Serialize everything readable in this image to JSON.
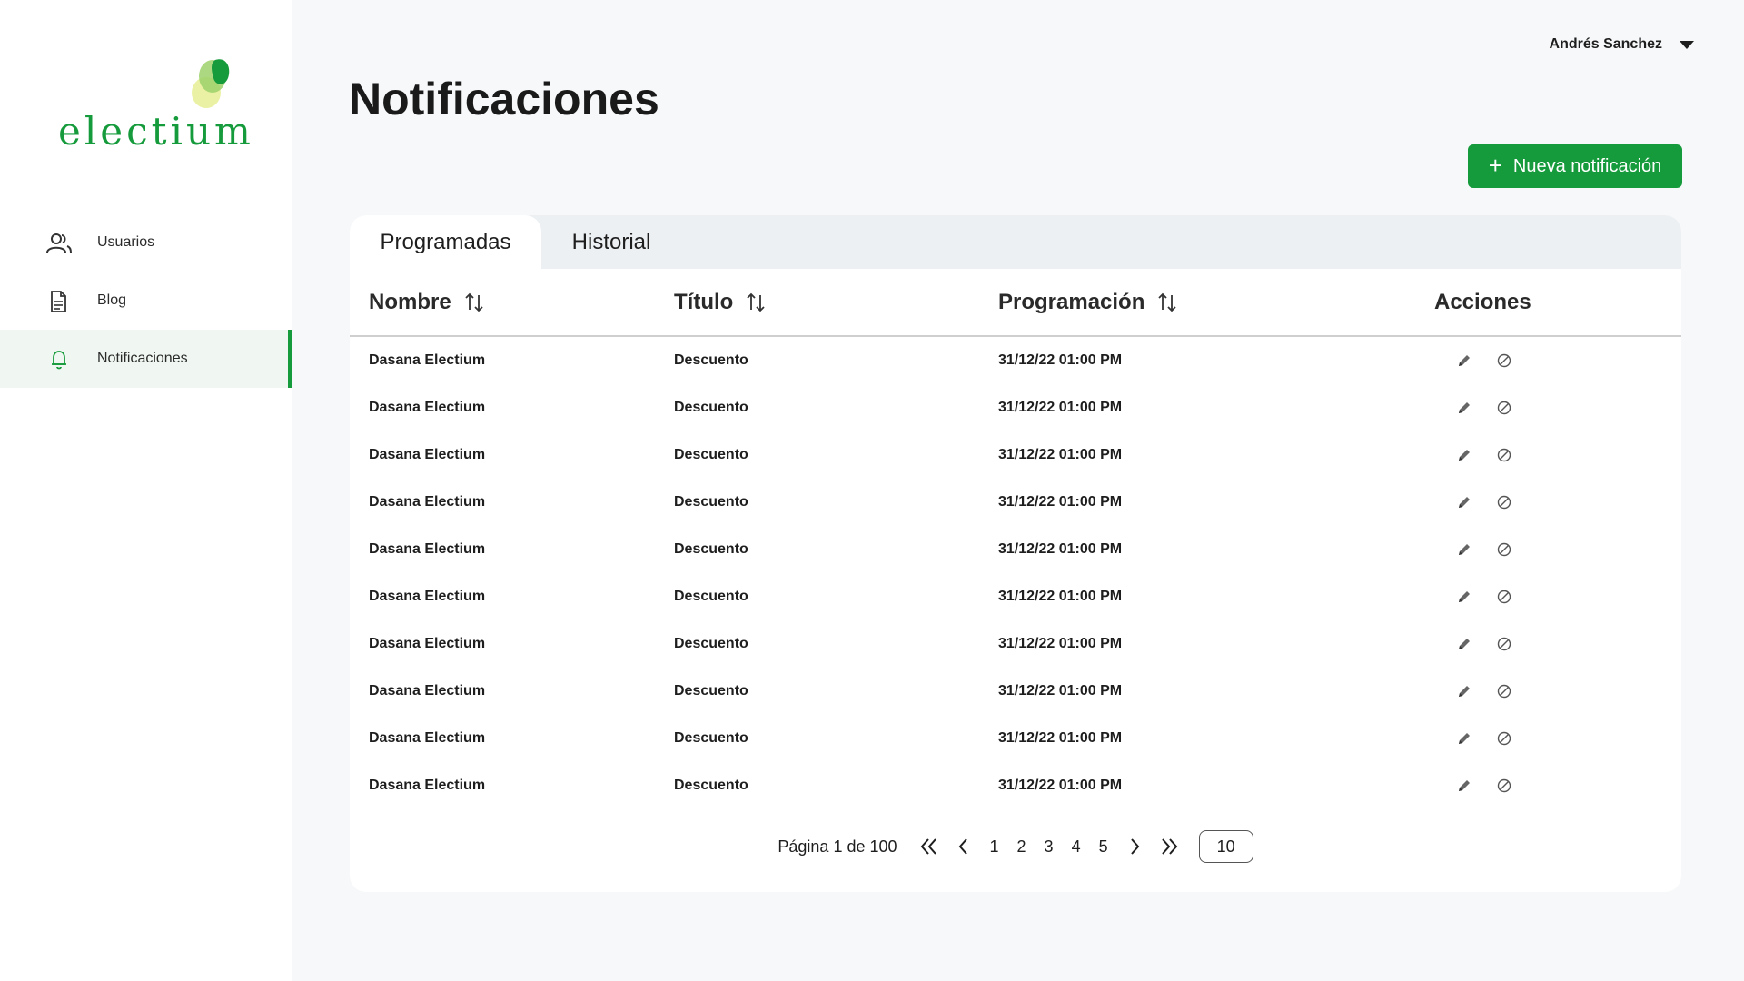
{
  "brand": {
    "name": "electium",
    "accent": "#169b3c"
  },
  "sidebar": {
    "items": [
      {
        "label": "Usuarios",
        "icon": "users-icon"
      },
      {
        "label": "Blog",
        "icon": "document-icon"
      },
      {
        "label": "Notificaciones",
        "icon": "bell-icon",
        "active": true
      }
    ]
  },
  "header": {
    "user_name": "Andrés Sanchez",
    "title": "Notificaciones",
    "new_button": "Nueva notificación"
  },
  "tabs": [
    {
      "label": "Programadas",
      "active": true
    },
    {
      "label": "Historial",
      "active": false
    }
  ],
  "table": {
    "columns": [
      "Nombre",
      "Título",
      "Programación",
      "Acciones"
    ],
    "rows": [
      {
        "name": "Dasana Electium",
        "title": "Descuento",
        "schedule": "31/12/22 01:00 PM"
      },
      {
        "name": "Dasana Electium",
        "title": "Descuento",
        "schedule": "31/12/22 01:00 PM"
      },
      {
        "name": "Dasana Electium",
        "title": "Descuento",
        "schedule": "31/12/22 01:00 PM"
      },
      {
        "name": "Dasana Electium",
        "title": "Descuento",
        "schedule": "31/12/22 01:00 PM"
      },
      {
        "name": "Dasana Electium",
        "title": "Descuento",
        "schedule": "31/12/22 01:00 PM"
      },
      {
        "name": "Dasana Electium",
        "title": "Descuento",
        "schedule": "31/12/22 01:00 PM"
      },
      {
        "name": "Dasana Electium",
        "title": "Descuento",
        "schedule": "31/12/22 01:00 PM"
      },
      {
        "name": "Dasana Electium",
        "title": "Descuento",
        "schedule": "31/12/22 01:00 PM"
      },
      {
        "name": "Dasana Electium",
        "title": "Descuento",
        "schedule": "31/12/22 01:00 PM"
      },
      {
        "name": "Dasana Electium",
        "title": "Descuento",
        "schedule": "31/12/22 01:00 PM"
      }
    ]
  },
  "pagination": {
    "info": "Página 1 de 100",
    "pages": [
      "1",
      "2",
      "3",
      "4",
      "5"
    ],
    "page_size": "10"
  }
}
